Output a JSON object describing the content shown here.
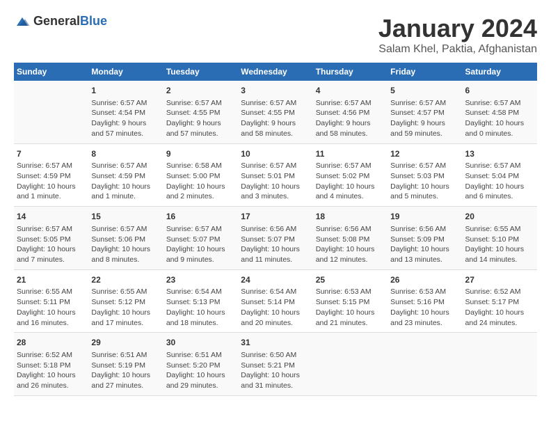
{
  "header": {
    "logo_general": "General",
    "logo_blue": "Blue",
    "title": "January 2024",
    "subtitle": "Salam Khel, Paktia, Afghanistan"
  },
  "calendar": {
    "days_of_week": [
      "Sunday",
      "Monday",
      "Tuesday",
      "Wednesday",
      "Thursday",
      "Friday",
      "Saturday"
    ],
    "weeks": [
      [
        {
          "day": "",
          "info": ""
        },
        {
          "day": "1",
          "info": "Sunrise: 6:57 AM\nSunset: 4:54 PM\nDaylight: 9 hours\nand 57 minutes."
        },
        {
          "day": "2",
          "info": "Sunrise: 6:57 AM\nSunset: 4:55 PM\nDaylight: 9 hours\nand 57 minutes."
        },
        {
          "day": "3",
          "info": "Sunrise: 6:57 AM\nSunset: 4:55 PM\nDaylight: 9 hours\nand 58 minutes."
        },
        {
          "day": "4",
          "info": "Sunrise: 6:57 AM\nSunset: 4:56 PM\nDaylight: 9 hours\nand 58 minutes."
        },
        {
          "day": "5",
          "info": "Sunrise: 6:57 AM\nSunset: 4:57 PM\nDaylight: 9 hours\nand 59 minutes."
        },
        {
          "day": "6",
          "info": "Sunrise: 6:57 AM\nSunset: 4:58 PM\nDaylight: 10 hours\nand 0 minutes."
        }
      ],
      [
        {
          "day": "7",
          "info": "Sunrise: 6:57 AM\nSunset: 4:59 PM\nDaylight: 10 hours\nand 1 minute."
        },
        {
          "day": "8",
          "info": "Sunrise: 6:57 AM\nSunset: 4:59 PM\nDaylight: 10 hours\nand 1 minute."
        },
        {
          "day": "9",
          "info": "Sunrise: 6:58 AM\nSunset: 5:00 PM\nDaylight: 10 hours\nand 2 minutes."
        },
        {
          "day": "10",
          "info": "Sunrise: 6:57 AM\nSunset: 5:01 PM\nDaylight: 10 hours\nand 3 minutes."
        },
        {
          "day": "11",
          "info": "Sunrise: 6:57 AM\nSunset: 5:02 PM\nDaylight: 10 hours\nand 4 minutes."
        },
        {
          "day": "12",
          "info": "Sunrise: 6:57 AM\nSunset: 5:03 PM\nDaylight: 10 hours\nand 5 minutes."
        },
        {
          "day": "13",
          "info": "Sunrise: 6:57 AM\nSunset: 5:04 PM\nDaylight: 10 hours\nand 6 minutes."
        }
      ],
      [
        {
          "day": "14",
          "info": "Sunrise: 6:57 AM\nSunset: 5:05 PM\nDaylight: 10 hours\nand 7 minutes."
        },
        {
          "day": "15",
          "info": "Sunrise: 6:57 AM\nSunset: 5:06 PM\nDaylight: 10 hours\nand 8 minutes."
        },
        {
          "day": "16",
          "info": "Sunrise: 6:57 AM\nSunset: 5:07 PM\nDaylight: 10 hours\nand 9 minutes."
        },
        {
          "day": "17",
          "info": "Sunrise: 6:56 AM\nSunset: 5:07 PM\nDaylight: 10 hours\nand 11 minutes."
        },
        {
          "day": "18",
          "info": "Sunrise: 6:56 AM\nSunset: 5:08 PM\nDaylight: 10 hours\nand 12 minutes."
        },
        {
          "day": "19",
          "info": "Sunrise: 6:56 AM\nSunset: 5:09 PM\nDaylight: 10 hours\nand 13 minutes."
        },
        {
          "day": "20",
          "info": "Sunrise: 6:55 AM\nSunset: 5:10 PM\nDaylight: 10 hours\nand 14 minutes."
        }
      ],
      [
        {
          "day": "21",
          "info": "Sunrise: 6:55 AM\nSunset: 5:11 PM\nDaylight: 10 hours\nand 16 minutes."
        },
        {
          "day": "22",
          "info": "Sunrise: 6:55 AM\nSunset: 5:12 PM\nDaylight: 10 hours\nand 17 minutes."
        },
        {
          "day": "23",
          "info": "Sunrise: 6:54 AM\nSunset: 5:13 PM\nDaylight: 10 hours\nand 18 minutes."
        },
        {
          "day": "24",
          "info": "Sunrise: 6:54 AM\nSunset: 5:14 PM\nDaylight: 10 hours\nand 20 minutes."
        },
        {
          "day": "25",
          "info": "Sunrise: 6:53 AM\nSunset: 5:15 PM\nDaylight: 10 hours\nand 21 minutes."
        },
        {
          "day": "26",
          "info": "Sunrise: 6:53 AM\nSunset: 5:16 PM\nDaylight: 10 hours\nand 23 minutes."
        },
        {
          "day": "27",
          "info": "Sunrise: 6:52 AM\nSunset: 5:17 PM\nDaylight: 10 hours\nand 24 minutes."
        }
      ],
      [
        {
          "day": "28",
          "info": "Sunrise: 6:52 AM\nSunset: 5:18 PM\nDaylight: 10 hours\nand 26 minutes."
        },
        {
          "day": "29",
          "info": "Sunrise: 6:51 AM\nSunset: 5:19 PM\nDaylight: 10 hours\nand 27 minutes."
        },
        {
          "day": "30",
          "info": "Sunrise: 6:51 AM\nSunset: 5:20 PM\nDaylight: 10 hours\nand 29 minutes."
        },
        {
          "day": "31",
          "info": "Sunrise: 6:50 AM\nSunset: 5:21 PM\nDaylight: 10 hours\nand 31 minutes."
        },
        {
          "day": "",
          "info": ""
        },
        {
          "day": "",
          "info": ""
        },
        {
          "day": "",
          "info": ""
        }
      ]
    ]
  }
}
